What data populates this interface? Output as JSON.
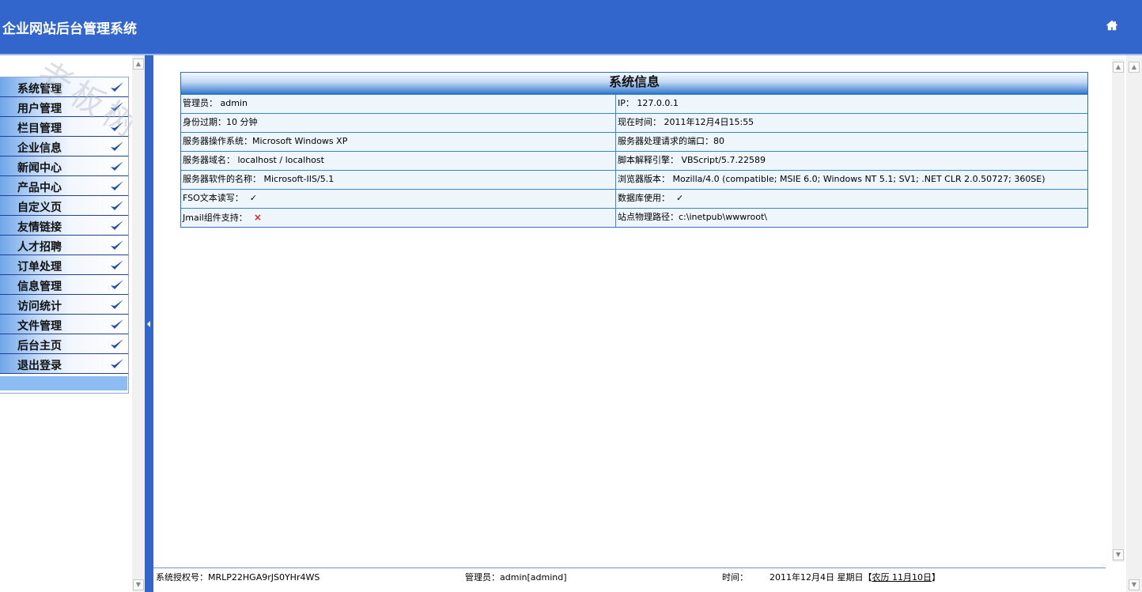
{
  "header": {
    "title": "企业网站后台管理系统",
    "home_icon": "home-icon"
  },
  "sidebar": {
    "watermark": "老板树",
    "items": [
      {
        "label": "系统管理"
      },
      {
        "label": "用户管理"
      },
      {
        "label": "栏目管理"
      },
      {
        "label": "企业信息"
      },
      {
        "label": "新闻中心"
      },
      {
        "label": "产品中心"
      },
      {
        "label": "自定义页"
      },
      {
        "label": "友情链接"
      },
      {
        "label": "人才招聘"
      },
      {
        "label": "订单处理"
      },
      {
        "label": "信息管理"
      },
      {
        "label": "访问统计"
      },
      {
        "label": "文件管理"
      },
      {
        "label": "后台主页"
      },
      {
        "label": "退出登录"
      }
    ]
  },
  "system_info": {
    "title": "系统信息",
    "rows": [
      {
        "left": "管理员： admin",
        "right": "IP： 127.0.0.1"
      },
      {
        "left": "身份过期：10 分钟",
        "right": "现在时间： 2011年12月4日15:55"
      },
      {
        "left": "服务器操作系统：Microsoft Windows XP",
        "right": "服务器处理请求的端口：80"
      },
      {
        "left": "服务器域名： localhost / localhost",
        "right": "脚本解释引擎： VBScript/5.7.22589"
      },
      {
        "left": "服务器软件的名称： Microsoft-IIS/5.1",
        "right": "浏览器版本： Mozilla/4.0 (compatible; MSIE 6.0; Windows NT 5.1; SV1; .NET CLR 2.0.50727; 360SE)"
      },
      {
        "left": "FSO文本读写：",
        "left_mark": "✓",
        "right": "数据库使用：",
        "right_mark": "✓"
      },
      {
        "left": "Jmail组件支持：",
        "left_mark_x": "×",
        "right": "站点物理路径：c:\\inetpub\\wwwroot\\"
      }
    ]
  },
  "footer": {
    "license": "系统授权号：MRLP22HGA9rJS0YHr4WS",
    "admin": "管理员：admin[admind]",
    "time_label": "时间：",
    "date": "2011年12月4日  星期日【",
    "lunar": "农历  11月10日",
    "close": "】"
  }
}
